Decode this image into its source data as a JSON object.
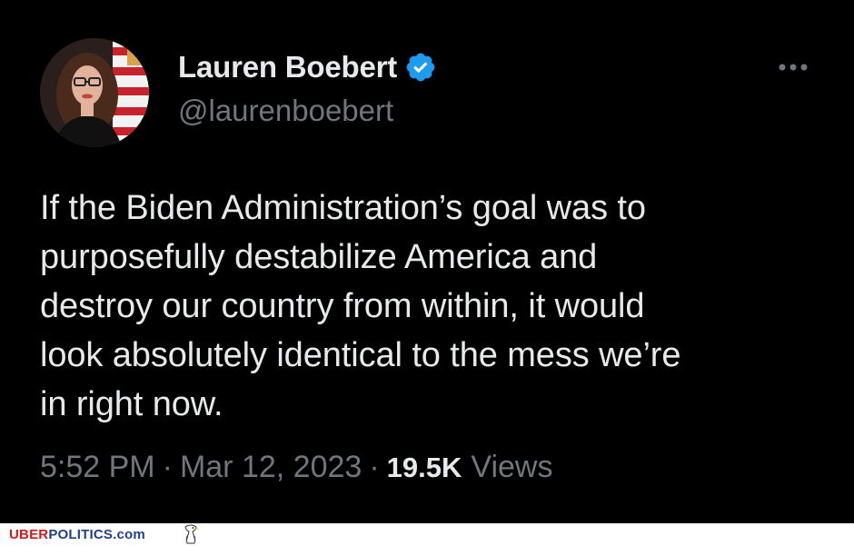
{
  "author": {
    "name": "Lauren Boebert",
    "handle": "@laurenboebert",
    "verified": true,
    "avatar_icon": "profile-photo"
  },
  "menu_icon": "more-options-icon",
  "tweet_lines": [
    "If the Biden Administration’s goal was to",
    "purposefully destabilize America and",
    "destroy our country from within, it would",
    "look absolutely identical to the mess we’re",
    "in right now."
  ],
  "meta": {
    "time": "5:52 PM",
    "separator": "·",
    "date": "Mar 12, 2023",
    "views_count": "19.5K",
    "views_label": "Views"
  },
  "watermark": {
    "uber": "UBER",
    "politics": "POLITICS",
    "suffix": ".com",
    "icon": "eagle-icon"
  },
  "colors": {
    "background": "#000000",
    "text": "#e7e9ea",
    "secondary": "#71767b",
    "verified": "#1d9bf0",
    "brand_red": "#d11a1a",
    "brand_blue": "#1f3f8f"
  }
}
